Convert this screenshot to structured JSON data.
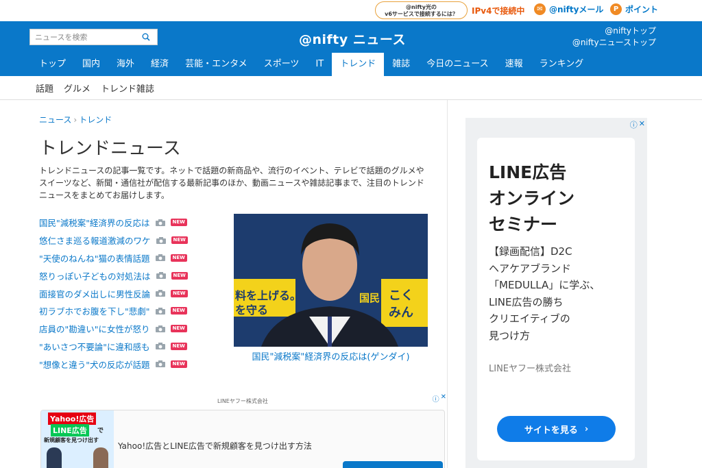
{
  "util": {
    "ipv6_line1": "@nifty光の",
    "ipv6_line2": "v6サービスで接続するには？",
    "ipv6_link": "IPv4で接続中",
    "mail": "@niftyメール",
    "point": "ポイント",
    "point_icon_letter": "P"
  },
  "header": {
    "search_placeholder": "ニュースを検索",
    "logo": "@nifty ニュース",
    "link_top": "@niftyトップ",
    "link_news_top": "@niftyニューストップ"
  },
  "nav": [
    "トップ",
    "国内",
    "海外",
    "経済",
    "芸能・エンタメ",
    "スポーツ",
    "IT",
    "トレンド",
    "雑誌",
    "今日のニュース",
    "速報",
    "ランキング"
  ],
  "nav_active": "トレンド",
  "subnav": [
    "話題",
    "グルメ",
    "トレンド雑誌"
  ],
  "breadcrumb": {
    "home": "ニュース",
    "sep": "›",
    "current": "トレンド"
  },
  "page": {
    "title": "トレンドニュース",
    "intro": "トレンドニュースの記事一覧です。ネットで話題の新商品や、流行のイベント、テレビで話題のグルメやスイーツなど、新聞・通信社が配信する最新記事のほか、動画ニュースや雑誌記事まで、注目のトレンドニュースをまとめてお届けします。"
  },
  "news": [
    "国民\"減税案\"経済界の反応は",
    "悠仁さま巡る報道激減のワケ",
    "\"天使のねんね\"猫の表情話題",
    "怒りっぽい子どもの対処法は",
    "面接官のダメ出しに男性反論",
    "初ラブホでお腹を下し\"悲劇\"",
    "店員の\"勘違い\"に女性が怒り",
    "\"あいさつ不要論\"に違和感も",
    "\"想像と違う\"犬の反応が話題"
  ],
  "new_badge": "NEW",
  "feature": {
    "caption": "国民\"減税案\"経済界の反応は(ゲンダイ)",
    "banner_left": "料を上げる。\nを守る",
    "banner_right": "国民",
    "banner_right2": "こく\nみん"
  },
  "ad1": {
    "label": "LINEヤフー株式会社",
    "thumb_line1": "Yahoo!広告",
    "thumb_line2": "LINE広告",
    "thumb_line3": "で",
    "thumb_line4": "新規顧客を見つけ出す",
    "text": "Yahoo!広告とLINE広告で新規顧客を見つけ出す方法"
  },
  "ad2": {
    "title": "LINE広告\nオンライン\nセミナー",
    "body": "【録画配信】D2C\nヘアケアブランド\n「MEDULLA」に学ぶ、\nLINE広告の勝ち\nクリエイティブの\n見つけ方",
    "company": "LINEヤフー株式会社",
    "button": "サイトを見る",
    "button_arrow": "›"
  },
  "ad_icons": {
    "info": "ⓘ",
    "close": "✕"
  },
  "colors": {
    "brand_blue": "#0a78c9",
    "new_badge": "#e8335a",
    "ipv6_orange": "#e8590c",
    "ad_button": "#0f7ce8"
  }
}
